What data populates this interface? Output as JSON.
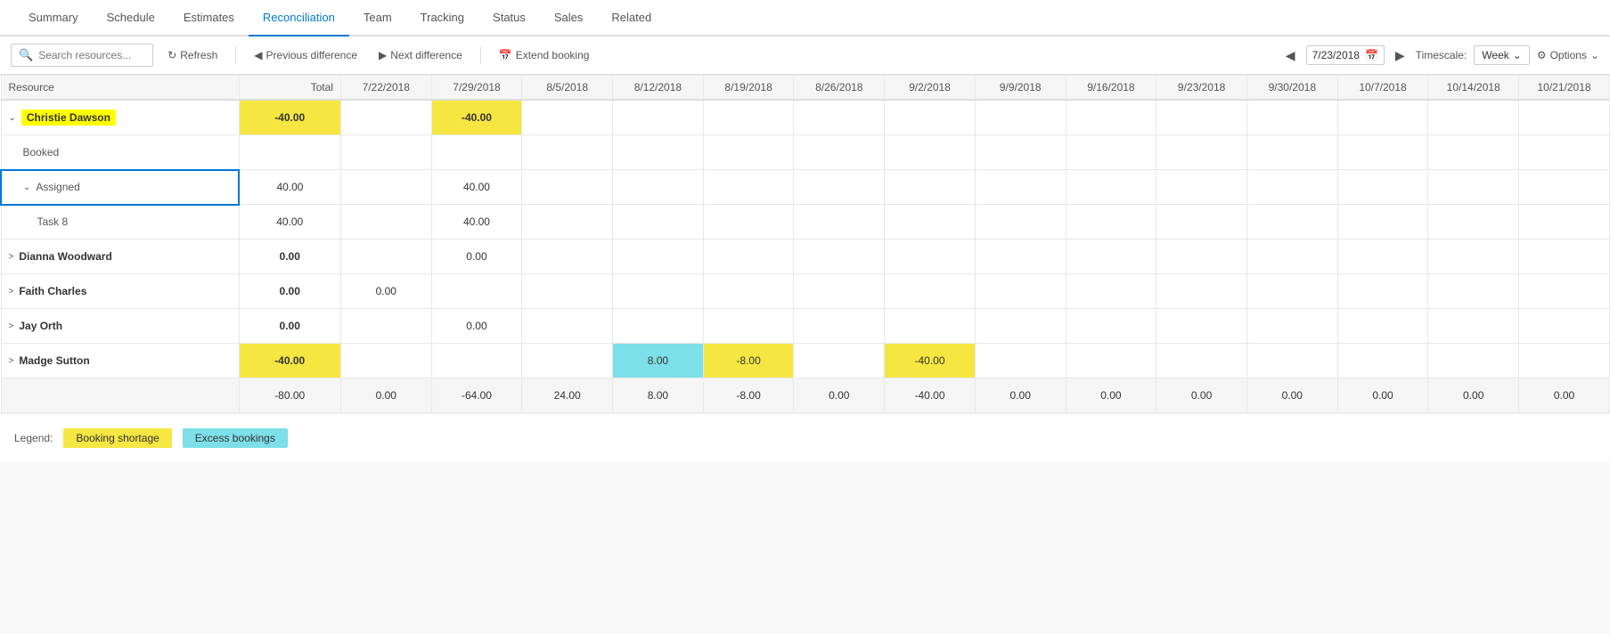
{
  "nav": {
    "tabs": [
      {
        "label": "Summary",
        "active": false
      },
      {
        "label": "Schedule",
        "active": false
      },
      {
        "label": "Estimates",
        "active": false
      },
      {
        "label": "Reconciliation",
        "active": true
      },
      {
        "label": "Team",
        "active": false
      },
      {
        "label": "Tracking",
        "active": false
      },
      {
        "label": "Status",
        "active": false
      },
      {
        "label": "Sales",
        "active": false
      },
      {
        "label": "Related",
        "active": false
      }
    ]
  },
  "toolbar": {
    "search_placeholder": "Search resources...",
    "refresh_label": "Refresh",
    "prev_diff_label": "Previous difference",
    "next_diff_label": "Next difference",
    "extend_booking_label": "Extend booking",
    "date_value": "7/23/2018",
    "timescale_label": "Timescale:",
    "timescale_value": "Week",
    "options_label": "Options"
  },
  "grid": {
    "headers": [
      "Resource",
      "Total",
      "7/22/2018",
      "7/29/2018",
      "8/5/2018",
      "8/12/2018",
      "8/19/2018",
      "8/26/2018",
      "9/2/2018",
      "9/9/2018",
      "9/16/2018",
      "9/23/2018",
      "9/30/2018",
      "10/7/2018",
      "10/14/2018",
      "10/21/2018"
    ],
    "rows": [
      {
        "type": "resource-main",
        "name": "Christie Dawson",
        "highlight": true,
        "total": "-40.00",
        "values": [
          "",
          "-40.00",
          "",
          "",
          "",
          "",
          "",
          "",
          "",
          "",
          "",
          "",
          "",
          "",
          ""
        ],
        "value_styles": [
          "",
          "bg-yellow",
          "",
          "",
          "",
          "",
          "",
          "",
          "",
          "",
          "",
          "",
          "",
          "",
          ""
        ],
        "expanded": true
      },
      {
        "type": "sub-label",
        "name": "Booked",
        "highlight": false,
        "total": "",
        "values": [
          "",
          "",
          "",
          "",
          "",
          "",
          "",
          "",
          "",
          "",
          "",
          "",
          "",
          "",
          ""
        ],
        "value_styles": [
          "",
          "",
          "",
          "",
          "",
          "",
          "",
          "",
          "",
          "",
          "",
          "",
          "",
          "",
          ""
        ]
      },
      {
        "type": "sub-group",
        "name": "Assigned",
        "highlight": false,
        "total": "40.00",
        "values": [
          "",
          "40.00",
          "",
          "",
          "",
          "",
          "",
          "",
          "",
          "",
          "",
          "",
          "",
          "",
          ""
        ],
        "value_styles": [
          "",
          "",
          "",
          "",
          "",
          "",
          "",
          "",
          "",
          "",
          "",
          "",
          "",
          "",
          ""
        ],
        "expanded": true
      },
      {
        "type": "task",
        "name": "Task 8",
        "highlight": false,
        "total": "40.00",
        "values": [
          "",
          "40.00",
          "",
          "",
          "",
          "",
          "",
          "",
          "",
          "",
          "",
          "",
          "",
          "",
          ""
        ],
        "value_styles": [
          "",
          "",
          "",
          "",
          "",
          "",
          "",
          "",
          "",
          "",
          "",
          "",
          "",
          "",
          ""
        ]
      },
      {
        "type": "resource-main",
        "name": "Dianna Woodward",
        "highlight": false,
        "total": "0.00",
        "values": [
          "",
          "0.00",
          "",
          "",
          "",
          "",
          "",
          "",
          "",
          "",
          "",
          "",
          "",
          "",
          ""
        ],
        "value_styles": [
          "",
          "",
          "",
          "",
          "",
          "",
          "",
          "",
          "",
          "",
          "",
          "",
          "",
          "",
          ""
        ],
        "expanded": false
      },
      {
        "type": "resource-main",
        "name": "Faith Charles",
        "highlight": false,
        "total": "0.00",
        "values": [
          "0.00",
          "",
          "",
          "",
          "",
          "",
          "",
          "",
          "",
          "",
          "",
          "",
          "",
          "",
          ""
        ],
        "value_styles": [
          "",
          "",
          "",
          "",
          "",
          "",
          "",
          "",
          "",
          "",
          "",
          "",
          "",
          "",
          ""
        ],
        "expanded": false
      },
      {
        "type": "resource-main",
        "name": "Jay Orth",
        "highlight": false,
        "total": "0.00",
        "values": [
          "",
          "0.00",
          "",
          "",
          "",
          "",
          "",
          "",
          "",
          "",
          "",
          "",
          "",
          "",
          ""
        ],
        "value_styles": [
          "",
          "",
          "",
          "",
          "",
          "",
          "",
          "",
          "",
          "",
          "",
          "",
          "",
          "",
          ""
        ],
        "expanded": false
      },
      {
        "type": "resource-main",
        "name": "Madge Sutton",
        "highlight": false,
        "total": "-40.00",
        "values": [
          "",
          "",
          "",
          "8.00",
          "-8.00",
          "",
          "-40.00",
          "",
          "",
          "",
          "",
          "",
          "",
          "",
          ""
        ],
        "value_styles": [
          "",
          "",
          "",
          "bg-cyan",
          "bg-yellow",
          "",
          "bg-yellow",
          "",
          "",
          "",
          "",
          "",
          "",
          "",
          ""
        ],
        "expanded": false,
        "total_style": "bg-yellow"
      }
    ],
    "total_row": {
      "label": "",
      "values": [
        "-80.00",
        "0.00",
        "-64.00",
        "24.00",
        "8.00",
        "-8.00",
        "0.00",
        "-40.00",
        "0.00",
        "0.00",
        "0.00",
        "0.00",
        "0.00",
        "0.00",
        "0.00"
      ]
    }
  },
  "legend": {
    "label": "Legend:",
    "shortage_label": "Booking shortage",
    "excess_label": "Excess bookings"
  }
}
